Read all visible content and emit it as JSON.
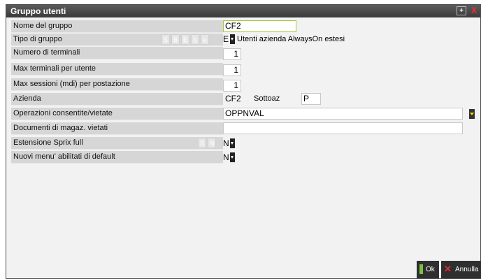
{
  "window": {
    "title": "Gruppo utenti",
    "maximize_icon": "+",
    "close_icon": "X"
  },
  "fields": [
    {
      "label": "Nome del gruppo",
      "value": "CF2"
    },
    {
      "label": "Tipo di gruppo",
      "value": "E",
      "chips": [
        "S",
        "B",
        "E",
        "b",
        "e"
      ],
      "description": "Utenti azienda AlwaysOn estesi"
    },
    {
      "label": "Numero di terminali",
      "value": "1"
    },
    {
      "label": "Max terminali per utente",
      "value": "1"
    },
    {
      "label": "Max sessioni (mdi) per postazione",
      "value": "1"
    },
    {
      "label": "Azienda",
      "value": "CF2",
      "sub_label": "Sottoaz",
      "sub_value": "P"
    },
    {
      "label": "Operazioni consentite/vietate",
      "value": "OPPNVAL"
    },
    {
      "label": "Documenti di magaz. vietati",
      "value": ""
    },
    {
      "label": "Estensione Sprix full",
      "value": "N",
      "chips": [
        "S",
        "N"
      ]
    },
    {
      "label": "Nuovi menu' abilitati di default",
      "value": "N"
    }
  ],
  "buttons": {
    "ok": "Ok",
    "cancel": "Annulla"
  },
  "colors": {
    "title_bar": "#3f3f3f",
    "ok_icon": "#7bc043",
    "cancel_icon": "#e03030",
    "dropdown_arrow": "#ffd800"
  }
}
